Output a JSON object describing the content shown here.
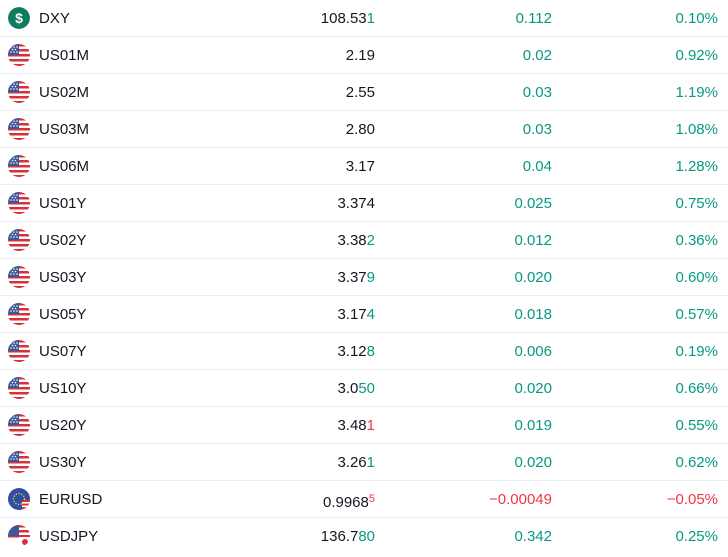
{
  "colors": {
    "up": "#089981",
    "down": "#f23645",
    "text": "#131722",
    "divider": "#e9ecf1"
  },
  "rows": [
    {
      "symbol": "DXY",
      "icon": "dollar-icon",
      "price_main": "108.53",
      "price_tail": "1",
      "tail_dir": "up",
      "tail_sup": false,
      "change": "0.112",
      "percent": "0.10%",
      "dir": "up"
    },
    {
      "symbol": "US01M",
      "icon": "us-flag-icon",
      "price_main": "2.19",
      "price_tail": "",
      "tail_dir": "none",
      "tail_sup": false,
      "change": "0.02",
      "percent": "0.92%",
      "dir": "up"
    },
    {
      "symbol": "US02M",
      "icon": "us-flag-icon",
      "price_main": "2.55",
      "price_tail": "",
      "tail_dir": "none",
      "tail_sup": false,
      "change": "0.03",
      "percent": "1.19%",
      "dir": "up"
    },
    {
      "symbol": "US03M",
      "icon": "us-flag-icon",
      "price_main": "2.80",
      "price_tail": "",
      "tail_dir": "none",
      "tail_sup": false,
      "change": "0.03",
      "percent": "1.08%",
      "dir": "up"
    },
    {
      "symbol": "US06M",
      "icon": "us-flag-icon",
      "price_main": "3.17",
      "price_tail": "",
      "tail_dir": "none",
      "tail_sup": false,
      "change": "0.04",
      "percent": "1.28%",
      "dir": "up"
    },
    {
      "symbol": "US01Y",
      "icon": "us-flag-icon",
      "price_main": "3.374",
      "price_tail": "",
      "tail_dir": "none",
      "tail_sup": false,
      "change": "0.025",
      "percent": "0.75%",
      "dir": "up"
    },
    {
      "symbol": "US02Y",
      "icon": "us-flag-icon",
      "price_main": "3.38",
      "price_tail": "2",
      "tail_dir": "up",
      "tail_sup": false,
      "change": "0.012",
      "percent": "0.36%",
      "dir": "up"
    },
    {
      "symbol": "US03Y",
      "icon": "us-flag-icon",
      "price_main": "3.37",
      "price_tail": "9",
      "tail_dir": "up",
      "tail_sup": false,
      "change": "0.020",
      "percent": "0.60%",
      "dir": "up"
    },
    {
      "symbol": "US05Y",
      "icon": "us-flag-icon",
      "price_main": "3.17",
      "price_tail": "4",
      "tail_dir": "up",
      "tail_sup": false,
      "change": "0.018",
      "percent": "0.57%",
      "dir": "up"
    },
    {
      "symbol": "US07Y",
      "icon": "us-flag-icon",
      "price_main": "3.12",
      "price_tail": "8",
      "tail_dir": "up",
      "tail_sup": false,
      "change": "0.006",
      "percent": "0.19%",
      "dir": "up"
    },
    {
      "symbol": "US10Y",
      "icon": "us-flag-icon",
      "price_main": "3.0",
      "price_tail": "50",
      "tail_dir": "up",
      "tail_sup": false,
      "change": "0.020",
      "percent": "0.66%",
      "dir": "up"
    },
    {
      "symbol": "US20Y",
      "icon": "us-flag-icon",
      "price_main": "3.48",
      "price_tail": "1",
      "tail_dir": "down",
      "tail_sup": false,
      "change": "0.019",
      "percent": "0.55%",
      "dir": "up"
    },
    {
      "symbol": "US30Y",
      "icon": "us-flag-icon",
      "price_main": "3.26",
      "price_tail": "1",
      "tail_dir": "up",
      "tail_sup": false,
      "change": "0.020",
      "percent": "0.62%",
      "dir": "up"
    },
    {
      "symbol": "EURUSD",
      "icon": "eu-us-flag-icon",
      "price_main": "0.9968",
      "price_tail": "5",
      "tail_dir": "down",
      "tail_sup": true,
      "change": "−0.00049",
      "percent": "−0.05%",
      "dir": "down"
    },
    {
      "symbol": "USDJPY",
      "icon": "us-jp-flag-icon",
      "price_main": "136.7",
      "price_tail": "80",
      "tail_dir": "up",
      "tail_sup": false,
      "change": "0.342",
      "percent": "0.25%",
      "dir": "up"
    }
  ]
}
